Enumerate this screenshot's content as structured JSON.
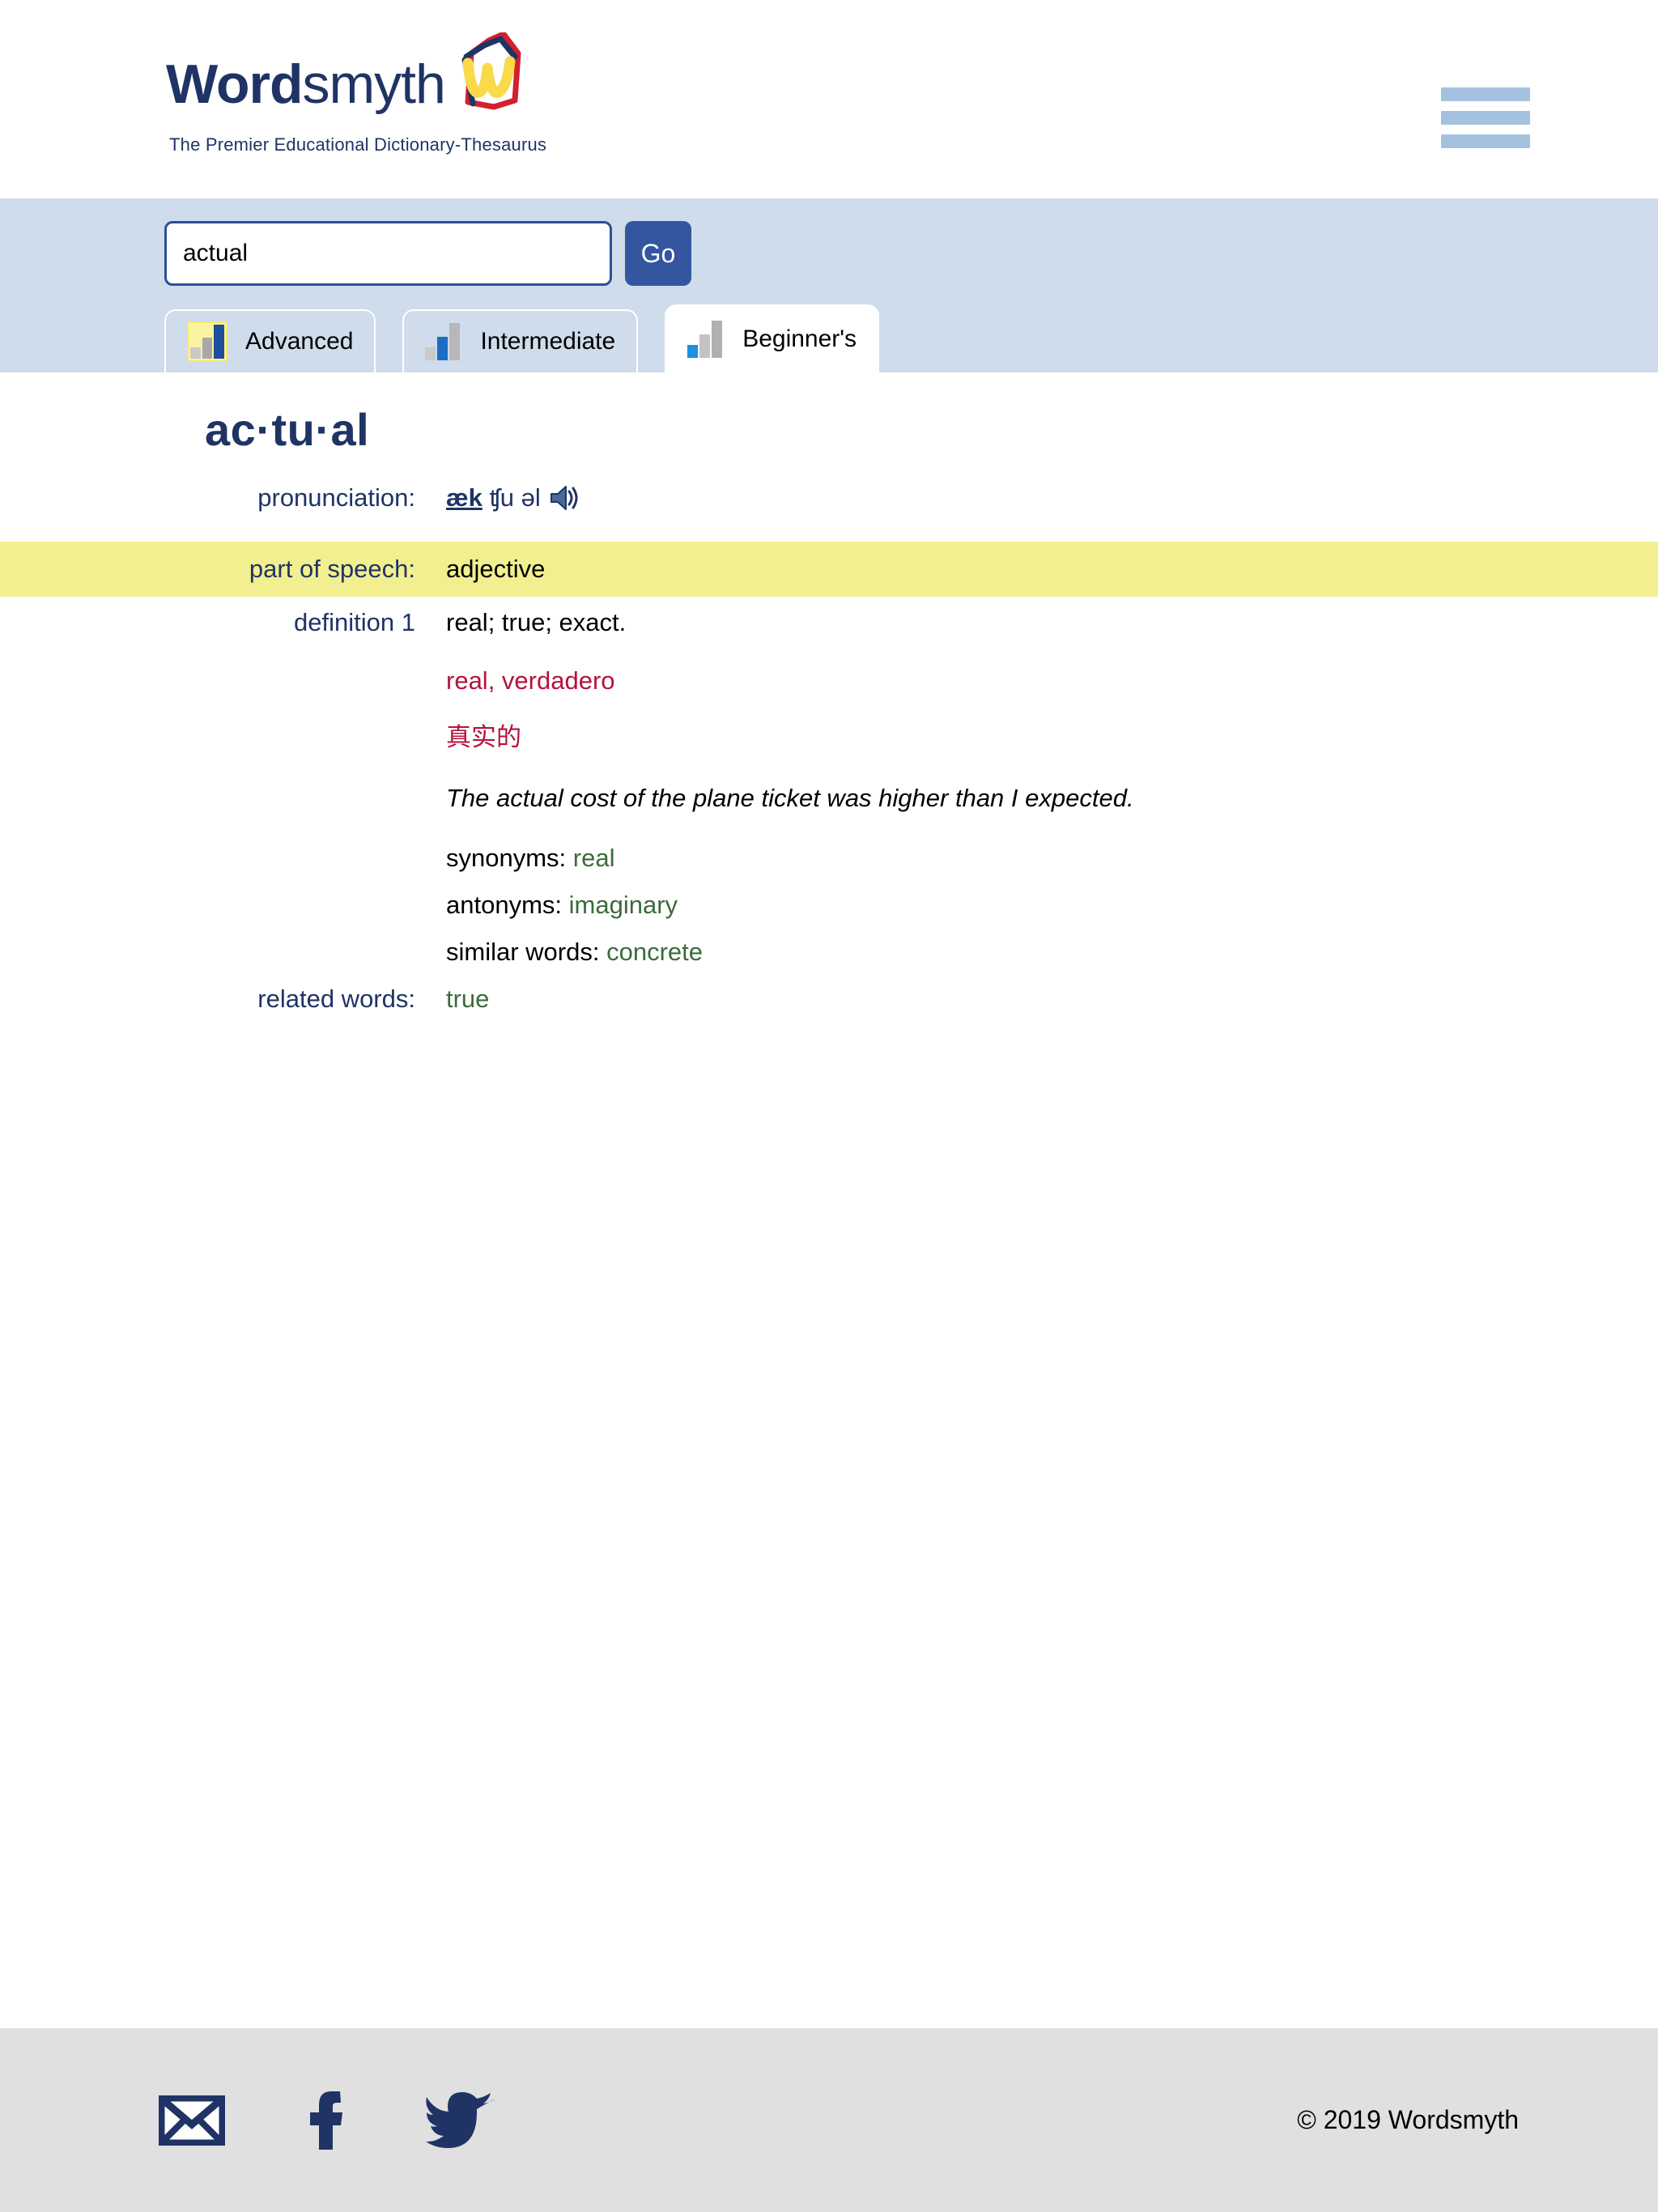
{
  "header": {
    "logo_word_bold": "Word",
    "logo_word_light": "smyth",
    "tagline": "The Premier Educational Dictionary-Thesaurus",
    "menu_icon": "hamburger-menu-icon"
  },
  "search": {
    "value": "actual",
    "placeholder": "",
    "go_label": "Go"
  },
  "tabs": [
    {
      "label": "Advanced",
      "active": false,
      "icon": "bar-chart-icon",
      "accent": "#1f4e9c",
      "swatch": "#fbf3a0"
    },
    {
      "label": "Intermediate",
      "active": false,
      "icon": "bar-chart-icon",
      "accent": "#1a6fc4",
      "swatch": ""
    },
    {
      "label": "Beginner's",
      "active": true,
      "icon": "bar-chart-icon",
      "accent": "#1e90df",
      "swatch": ""
    }
  ],
  "entry": {
    "headword": "ac·tu·al",
    "pronunciation_label": "pronunciation:",
    "pronunciation_stress": "æk",
    "pronunciation_rest": "ʧu əl",
    "speaker_icon": "speaker-audio-icon",
    "pos_label": "part of speech:",
    "pos_value": "adjective",
    "definition_label": "definition 1",
    "definition_text": "real; true; exact.",
    "translation_es": "real, verdadero",
    "translation_zh": "真实的",
    "example": "The actual cost of the plane ticket was higher than I expected.",
    "synonyms_label": "synonyms:",
    "synonyms_value": "real",
    "antonyms_label": "antonyms:",
    "antonyms_value": "imaginary",
    "similar_label": "similar words:",
    "similar_value": "concrete",
    "related_label": "related words:",
    "related_value": "true"
  },
  "footer": {
    "email_icon": "email-envelope-icon",
    "facebook_icon": "facebook-icon",
    "twitter_icon": "twitter-bird-icon",
    "copyright": "© 2019 Wordsmyth"
  },
  "colors": {
    "brand_navy": "#1f3465",
    "search_band": "#cedcec",
    "highlight_yellow": "#f2ef90",
    "translation_red": "#b5123a",
    "link_green": "#3c6b3c",
    "footer_gray": "#e0e0e0"
  }
}
